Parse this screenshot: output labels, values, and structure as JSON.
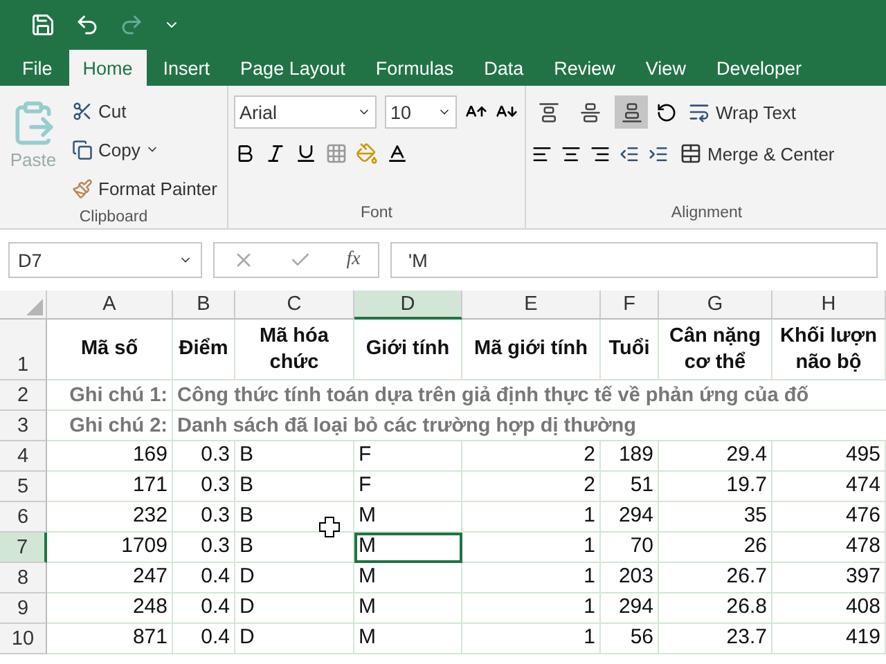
{
  "tabs": [
    {
      "label": "File",
      "selected": false
    },
    {
      "label": "Home",
      "selected": true
    },
    {
      "label": "Insert",
      "selected": false
    },
    {
      "label": "Page Layout",
      "selected": false
    },
    {
      "label": "Formulas",
      "selected": false
    },
    {
      "label": "Data",
      "selected": false
    },
    {
      "label": "Review",
      "selected": false
    },
    {
      "label": "View",
      "selected": false
    },
    {
      "label": "Developer",
      "selected": false
    }
  ],
  "clipboard": {
    "paste": "Paste",
    "cut": "Cut",
    "copy": "Copy",
    "format_painter": "Format Painter",
    "label": "Clipboard"
  },
  "font": {
    "name": "Arial",
    "size": "10",
    "label": "Font"
  },
  "alignment": {
    "vertical_buttons": [
      {
        "selected": false
      },
      {
        "selected": false
      },
      {
        "selected": true
      }
    ],
    "wrap_text": "Wrap Text",
    "merge": "Merge & Center",
    "label": "Alignment"
  },
  "formula_bar": {
    "name_box": "D7",
    "function_label": "fx",
    "value": "'M"
  },
  "columns": [
    {
      "label": "A",
      "kind": "number",
      "selected": false
    },
    {
      "label": "B",
      "kind": "number",
      "selected": false
    },
    {
      "label": "C",
      "kind": "text",
      "selected": false
    },
    {
      "label": "D",
      "kind": "text",
      "selected": true
    },
    {
      "label": "E",
      "kind": "number",
      "selected": false
    },
    {
      "label": "F",
      "kind": "number",
      "selected": false
    },
    {
      "label": "G",
      "kind": "number",
      "selected": false
    },
    {
      "label": "H",
      "kind": "number",
      "selected": false
    }
  ],
  "rows": [
    {
      "number": "1",
      "kind": "header",
      "selected": false,
      "cells": [
        "Mã số",
        "Điểm",
        "Mã hóa chức",
        "Giới tính",
        "Mã giới tính",
        "Tuổi",
        "Cân nặng cơ thể",
        "Khối lượn não bộ"
      ]
    },
    {
      "number": "2",
      "kind": "note",
      "selected": false,
      "label": "Ghi chú 1:",
      "text": "Công thức tính toán dựa trên giả định thực tế về phản ứng của đố"
    },
    {
      "number": "3",
      "kind": "note",
      "selected": false,
      "label": "Ghi chú 2:",
      "text": "Danh sách đã loại bỏ các trường hợp dị thường"
    },
    {
      "number": "4",
      "kind": "data",
      "selected": false,
      "cells": [
        "169",
        "0.3",
        "B",
        "F",
        "2",
        "189",
        "29.4",
        "495"
      ]
    },
    {
      "number": "5",
      "kind": "data",
      "selected": false,
      "cells": [
        "171",
        "0.3",
        "B",
        "F",
        "2",
        "51",
        "19.7",
        "474"
      ]
    },
    {
      "number": "6",
      "kind": "data",
      "selected": false,
      "cells": [
        "232",
        "0.3",
        "B",
        "M",
        "1",
        "294",
        "35",
        "476"
      ]
    },
    {
      "number": "7",
      "kind": "data",
      "selected": true,
      "cells": [
        "1709",
        "0.3",
        "B",
        "M",
        "1",
        "70",
        "26",
        "478"
      ]
    },
    {
      "number": "8",
      "kind": "data",
      "selected": false,
      "cells": [
        "247",
        "0.4",
        "D",
        "M",
        "1",
        "203",
        "26.7",
        "397"
      ]
    },
    {
      "number": "9",
      "kind": "data",
      "selected": false,
      "cells": [
        "248",
        "0.4",
        "D",
        "M",
        "1",
        "294",
        "26.8",
        "408"
      ]
    },
    {
      "number": "10",
      "kind": "data",
      "selected": false,
      "cells": [
        "871",
        "0.4",
        "D",
        "M",
        "1",
        "56",
        "23.7",
        "419"
      ]
    }
  ]
}
